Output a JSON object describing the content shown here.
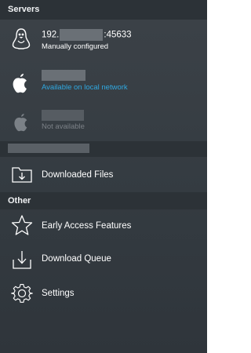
{
  "servers": {
    "header": "Servers",
    "items": [
      {
        "title_prefix": "192.",
        "title_suffix": ":45633",
        "subtitle": "Manually configured",
        "icon": "linux-tux-icon"
      },
      {
        "subtitle": "Available on local network",
        "icon": "apple-icon",
        "subtitle_color": "#2fa8e0"
      },
      {
        "subtitle": "Not available",
        "icon": "apple-icon-disabled",
        "subtitle_color": "#7b8187"
      }
    ]
  },
  "downloads": {
    "label": "Downloaded Files",
    "icon": "downloaded-folder-icon"
  },
  "other": {
    "header": "Other",
    "items": [
      {
        "label": "Early Access Features",
        "icon": "star-icon"
      },
      {
        "label": "Download Queue",
        "icon": "download-tray-icon"
      },
      {
        "label": "Settings",
        "icon": "gear-icon"
      }
    ]
  },
  "colors": {
    "panel_bg": "#3c4248",
    "header_bg": "#2c3237",
    "accent_blue": "#2fa8e0",
    "disabled_text": "#7b8187"
  }
}
